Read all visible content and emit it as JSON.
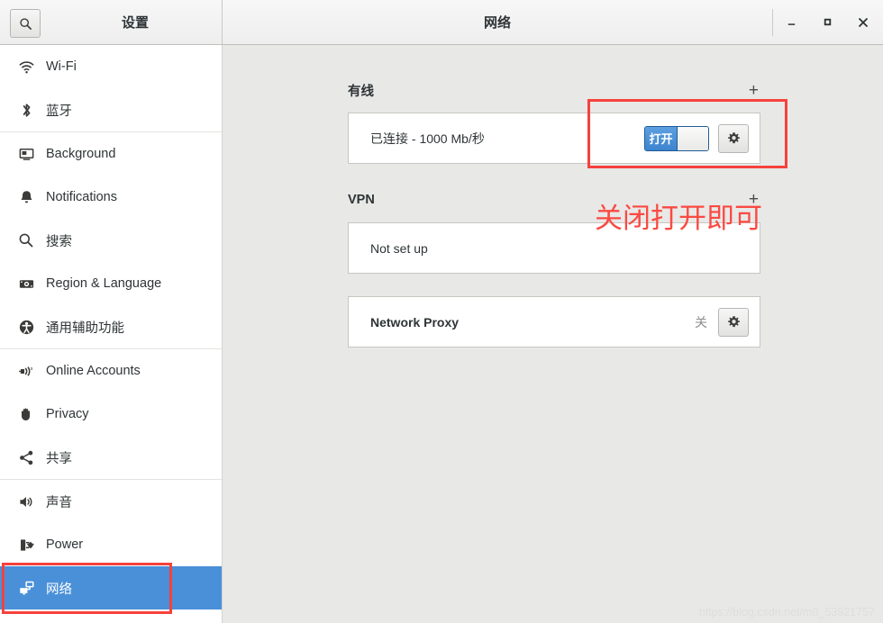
{
  "window": {
    "settings_title": "设置",
    "page_title": "网络",
    "minimize_label": "−",
    "maximize_label": "□",
    "close_label": "✕"
  },
  "sidebar": {
    "search_icon": "search-icon",
    "items": [
      {
        "label": "Wi-Fi",
        "icon": "wifi-icon",
        "selected": false,
        "sep_after": false
      },
      {
        "label": "蓝牙",
        "icon": "bluetooth-icon",
        "selected": false,
        "sep_after": true
      },
      {
        "label": "Background",
        "icon": "background-icon",
        "selected": false,
        "sep_after": false
      },
      {
        "label": "Notifications",
        "icon": "bell-icon",
        "selected": false,
        "sep_after": false
      },
      {
        "label": "搜索",
        "icon": "search-icon",
        "selected": false,
        "sep_after": false
      },
      {
        "label": "Region & Language",
        "icon": "region-language-icon",
        "selected": false,
        "sep_after": false
      },
      {
        "label": "通用辅助功能",
        "icon": "accessibility-icon",
        "selected": false,
        "sep_after": true
      },
      {
        "label": "Online Accounts",
        "icon": "online-accounts-icon",
        "selected": false,
        "sep_after": false
      },
      {
        "label": "Privacy",
        "icon": "privacy-hand-icon",
        "selected": false,
        "sep_after": false
      },
      {
        "label": "共享",
        "icon": "share-icon",
        "selected": false,
        "sep_after": true
      },
      {
        "label": "声音",
        "icon": "sound-icon",
        "selected": false,
        "sep_after": false
      },
      {
        "label": "Power",
        "icon": "power-plug-icon",
        "selected": false,
        "sep_after": false
      },
      {
        "label": "网络",
        "icon": "network-icon",
        "selected": true,
        "sep_after": false
      }
    ]
  },
  "main": {
    "wired": {
      "title": "有线",
      "add_label": "+",
      "status": "已连接 - 1000 Mb/秒",
      "toggle_state_label": "打开",
      "toggle_on": true,
      "settings_icon": "gear-icon"
    },
    "vpn": {
      "title": "VPN",
      "add_label": "+",
      "status": "Not set up"
    },
    "proxy": {
      "title": "Network Proxy",
      "state_label": "关",
      "settings_icon": "gear-icon"
    }
  },
  "annotations": {
    "callout_text": "关闭打开即可",
    "box_color": "#f5423c",
    "text_color": "#fa4a42"
  },
  "watermark": "https://blog.csdn.net/m0_53521757",
  "colors": {
    "accent_blue": "#4a90d9",
    "content_bg": "#e8e8e7",
    "sidebar_bg": "#ffffff",
    "header_bg": "#f2f2f1"
  }
}
